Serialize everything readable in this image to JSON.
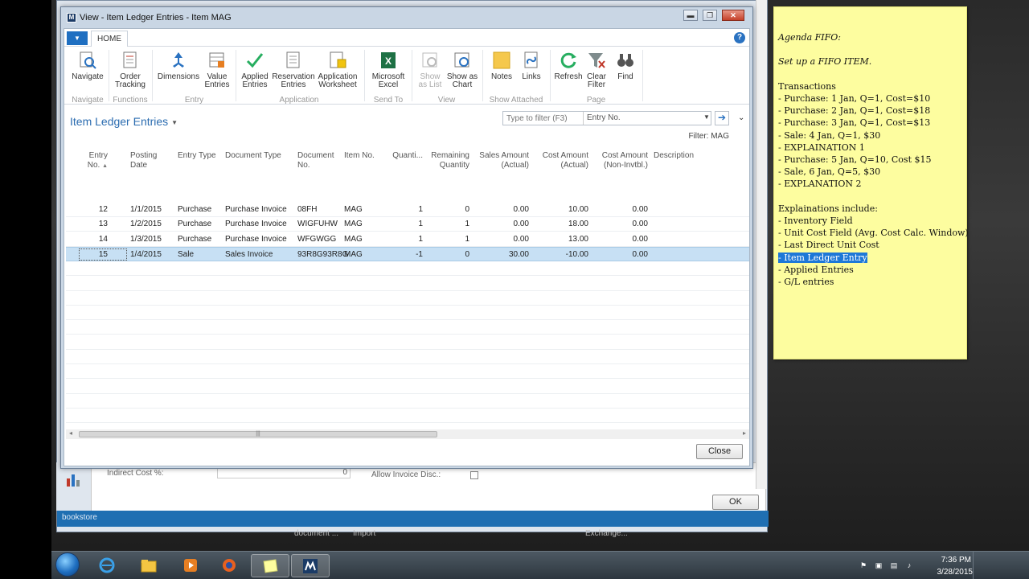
{
  "dialog": {
    "title": "View - Item Ledger Entries - Item MAG",
    "min_glyph": "▬",
    "max_glyph": "❐",
    "close_glyph": "✕",
    "tab_home": "HOME",
    "app_menu_glyph": "▼",
    "help_glyph": "?",
    "page_title": "Item Ledger Entries",
    "page_title_caret": "▼",
    "filter_placeholder": "Type to filter (F3)",
    "filter_field": "Entry No.",
    "filter_dd_glyph": "▼",
    "filter_go_glyph": "➔",
    "collapse_glyph": "⌄",
    "filter_summary": "Filter: MAG",
    "close_button": "Close",
    "hscroll_left": "◂",
    "hscroll_right": "▸",
    "hscroll_grip": "|||",
    "vscroll_up": "▴",
    "vscroll_down": "▾"
  },
  "ribbon": {
    "buttons": {
      "navigate": "Navigate",
      "order_tracking_1": "Order",
      "order_tracking_2": "Tracking",
      "dimensions": "Dimensions",
      "value_entries_1": "Value",
      "value_entries_2": "Entries",
      "applied_entries_1": "Applied",
      "applied_entries_2": "Entries",
      "reservation_entries_1": "Reservation",
      "reservation_entries_2": "Entries",
      "application_worksheet_1": "Application",
      "application_worksheet_2": "Worksheet",
      "microsoft_excel_1": "Microsoft",
      "microsoft_excel_2": "Excel",
      "show_as_list_1": "Show",
      "show_as_list_2": "as List",
      "show_as_chart_1": "Show as",
      "show_as_chart_2": "Chart",
      "notes": "Notes",
      "links": "Links",
      "refresh": "Refresh",
      "clear_filter_1": "Clear",
      "clear_filter_2": "Filter",
      "find": "Find"
    },
    "groups": {
      "navigate": "Navigate",
      "functions": "Functions",
      "entry": "Entry",
      "application": "Application",
      "send_to": "Send To",
      "view": "View",
      "show_attached": "Show Attached",
      "page": "Page"
    }
  },
  "grid": {
    "headers": {
      "entry_no_1": "Entry",
      "entry_no_2": "No.",
      "sort_glyph": "▲",
      "posting_date_1": "Posting",
      "posting_date_2": "Date",
      "entry_type": "Entry Type",
      "document_type": "Document Type",
      "document_no_1": "Document",
      "document_no_2": "No.",
      "item_no": "Item No.",
      "quantity": "Quanti...",
      "remaining_quantity_1": "Remaining",
      "remaining_quantity_2": "Quantity",
      "sales_amount_1": "Sales Amount",
      "sales_amount_2": "(Actual)",
      "cost_amount_1": "Cost Amount",
      "cost_amount_2": "(Actual)",
      "cost_amount_noninv_1": "Cost Amount",
      "cost_amount_noninv_2": "(Non-Invtbl.)",
      "description": "Description"
    },
    "rows": [
      {
        "entry_no": "12",
        "posting_date": "1/1/2015",
        "entry_type": "Purchase",
        "document_type": "Purchase Invoice",
        "document_no": "08FH",
        "item_no": "MAG",
        "quantity": "1",
        "remaining_quantity": "0",
        "sales_amount": "0.00",
        "cost_amount": "10.00",
        "cost_amount_noninv": "0.00"
      },
      {
        "entry_no": "13",
        "posting_date": "1/2/2015",
        "entry_type": "Purchase",
        "document_type": "Purchase Invoice",
        "document_no": "WIGFUHW",
        "item_no": "MAG",
        "quantity": "1",
        "remaining_quantity": "1",
        "sales_amount": "0.00",
        "cost_amount": "18.00",
        "cost_amount_noninv": "0.00"
      },
      {
        "entry_no": "14",
        "posting_date": "1/3/2015",
        "entry_type": "Purchase",
        "document_type": "Purchase Invoice",
        "document_no": "WFGWGG",
        "item_no": "MAG",
        "quantity": "1",
        "remaining_quantity": "1",
        "sales_amount": "0.00",
        "cost_amount": "13.00",
        "cost_amount_noninv": "0.00"
      },
      {
        "entry_no": "15",
        "posting_date": "1/4/2015",
        "entry_type": "Sale",
        "document_type": "Sales Invoice",
        "document_no": "93R8G93R8G",
        "item_no": "MAG",
        "quantity": "-1",
        "remaining_quantity": "0",
        "sales_amount": "30.00",
        "cost_amount": "-10.00",
        "cost_amount_noninv": "0.00"
      }
    ]
  },
  "background_window": {
    "indirect_cost_label": "Indirect Cost %:",
    "indirect_cost_value": "0",
    "allow_invoice_disc_label": "Allow Invoice Disc.:",
    "status_company": "bookstore",
    "ok_button": "OK",
    "tile_document": "document ...",
    "tile_import": "Import",
    "tile_exchange": "Exchange..."
  },
  "sticky_note": {
    "lines": [
      {
        "text": "Agenda FIFO:",
        "style": "it"
      },
      {
        "text": "",
        "style": ""
      },
      {
        "text": "Set up a FIFO ITEM.",
        "style": "it"
      },
      {
        "text": "",
        "style": ""
      },
      {
        "text": "Transactions",
        "style": ""
      },
      {
        "text": "- Purchase: 1 Jan, Q=1, Cost=$10",
        "style": ""
      },
      {
        "text": "- Purchase: 2 Jan, Q=1, Cost=$18",
        "style": ""
      },
      {
        "text": "- Purchase: 3 Jan, Q=1, Cost=$13",
        "style": ""
      },
      {
        "text": "- Sale: 4 Jan, Q=1, $30",
        "style": ""
      },
      {
        "text": "- EXPLAINATION 1",
        "style": ""
      },
      {
        "text": "- Purchase: 5 Jan, Q=10, Cost $15",
        "style": ""
      },
      {
        "text": "- Sale, 6 Jan, Q=5, $30",
        "style": ""
      },
      {
        "text": "- EXPLANATION 2",
        "style": ""
      },
      {
        "text": "",
        "style": ""
      },
      {
        "text": "Explainations include:",
        "style": ""
      },
      {
        "text": "- Inventory Field",
        "style": ""
      },
      {
        "text": "- Unit Cost Field (Avg. Cost Calc. Window)",
        "style": ""
      },
      {
        "text": "- Last Direct Unit Cost",
        "style": ""
      },
      {
        "text": "- Item Ledger Entry",
        "style": "hl"
      },
      {
        "text": "- Applied Entries",
        "style": ""
      },
      {
        "text": "- G/L entries",
        "style": ""
      }
    ]
  },
  "taskbar": {
    "time": "7:36 PM",
    "date": "3/28/2015",
    "app_icon_glyph": "M"
  },
  "colors": {
    "accent": "#2b6cb0",
    "selection": "#c7e0f4",
    "sticky": "#fdfd9f",
    "highlight": "#1e78d7"
  }
}
